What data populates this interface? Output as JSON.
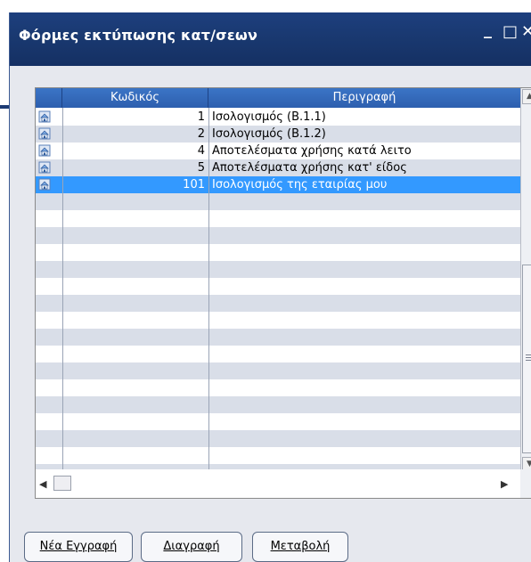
{
  "window": {
    "title": "Φόρμες εκτύπωσης κατ/σεων",
    "minimize_glyph": "_",
    "maximize_glyph": "□",
    "close_glyph": "✕"
  },
  "grid": {
    "columns": {
      "code": "Κωδικός",
      "description": "Περιγραφή"
    },
    "rows": [
      {
        "code": "1",
        "description": "Ισολογισμός (Β.1.1)"
      },
      {
        "code": "2",
        "description": "Ισολογισμός (Β.1.2)"
      },
      {
        "code": "4",
        "description": "Αποτελέσματα χρήσης κατά λειτο"
      },
      {
        "code": "5",
        "description": "Αποτελέσματα χρήσης κατ' είδος"
      },
      {
        "code": "101",
        "description": "Ισολογισμός της εταιρίας μου"
      }
    ],
    "selected_index": 4,
    "row_icon": "house-icon"
  },
  "buttons": {
    "new_record": "Νέα Εγγραφή",
    "delete": "Διαγραφή",
    "modify": "Μεταβολή"
  },
  "colors": {
    "titlebar": "#19386f",
    "header": "#2d5fae",
    "selected_row": "#3399ff",
    "alt_row": "#d9dee8"
  }
}
